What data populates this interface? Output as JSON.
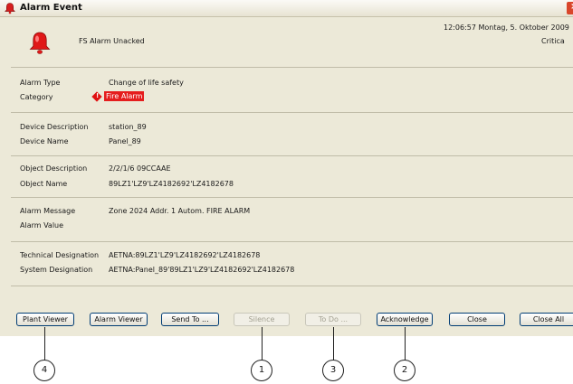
{
  "window": {
    "title": "Alarm Event"
  },
  "header": {
    "state": "FS Alarm Unacked",
    "timestamp": "12:06:57 Montag, 5. Oktober 2009",
    "severity": "Critica"
  },
  "fields": {
    "alarm_type": {
      "label": "Alarm Type",
      "value": "Change of life safety"
    },
    "category": {
      "label": "Category",
      "value": "Fire Alarm"
    },
    "device_description": {
      "label": "Device Description",
      "value": "station_89"
    },
    "device_name": {
      "label": "Device Name",
      "value": "Panel_89"
    },
    "object_description": {
      "label": "Object Description",
      "value": "2/2/1/6 09CCAAE"
    },
    "object_name": {
      "label": "Object Name",
      "value": "89LZ1'LZ9'LZ4182692'LZ4182678"
    },
    "alarm_message": {
      "label": "Alarm Message",
      "value": "Zone 2024 Addr. 1 Autom. FIRE ALARM"
    },
    "alarm_value": {
      "label": "Alarm Value",
      "value": ""
    },
    "technical_designation": {
      "label": "Technical Designation",
      "value": "AETNA:89LZ1'LZ9'LZ4182692'LZ4182678"
    },
    "system_designation": {
      "label": "System Designation",
      "value": "AETNA:Panel_89'89LZ1'LZ9'LZ4182692'LZ4182678"
    }
  },
  "buttons": {
    "plant_viewer": "Plant Viewer",
    "alarm_viewer": "Alarm Viewer",
    "send_to": "Send To ...",
    "silence": "Silence",
    "to_do": "To Do ...",
    "acknowledge": "Acknowledge",
    "close": "Close",
    "close_all": "Close All"
  },
  "callouts": {
    "plant_viewer": "4",
    "silence": "1",
    "to_do": "3",
    "acknowledge": "2"
  },
  "colors": {
    "alarm_red": "#e51d1d",
    "window_bg": "#ece9d8",
    "button_border": "#003c74"
  },
  "icons": {
    "window": "alarm-bell-icon",
    "header": "alarm-bell-icon",
    "category": "fire-diamond-icon"
  }
}
